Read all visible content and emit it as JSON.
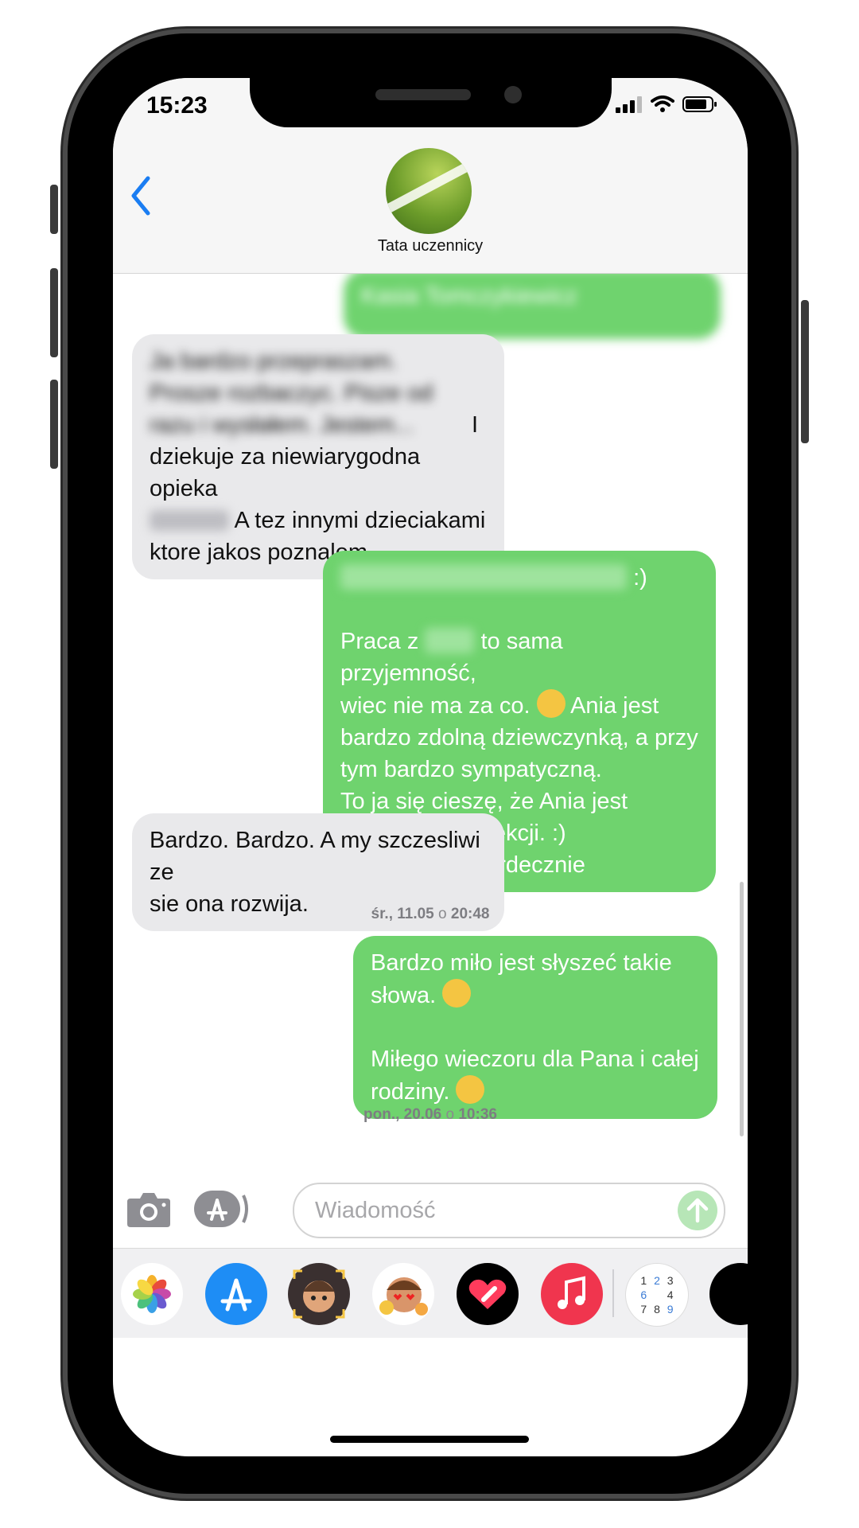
{
  "status": {
    "time": "15:23"
  },
  "header": {
    "contact_name": "Tata uczennicy",
    "back_icon": "chevron-left-icon"
  },
  "messages": [
    {
      "type": "out",
      "text": "Kasia Tomczykiewicz",
      "blurred": true
    },
    {
      "type": "in",
      "text_blurred": "Ja bardzo przepraszam. Prosze rozbaczyc. Pisze od razu i wysłałem. Jestem...",
      "text_visible_1": "I",
      "text_visible_2": "dziekuje za niewiarygodna opieka",
      "text_visible_3": "A tez innymi dzieciakami",
      "text_visible_4": "ktore jakos poznalem."
    },
    {
      "type": "out",
      "line_1_suffix": ":)",
      "line_2": "Praca z",
      "line_2_suffix": "to sama przyjemność,",
      "rest": "wiec nie ma za co.",
      "rest_2": "Ania jest\nbardzo zdolną dziewczynką, a przy\ntym bardzo sympatyczną.\nTo ja się cieszę, że Ania jest\nzadowolona z lekcji. :)\nPozdrawiam serdecznie"
    },
    {
      "type": "in",
      "text": "Bardzo. Bardzo. A my szczesliwi ze\nsie ona rozwija."
    },
    {
      "type": "stamp",
      "day": "śr., 11.05",
      "sep": "o",
      "time": "20:48"
    },
    {
      "type": "out",
      "line_1": "Bardzo miło jest słyszeć takie\nsłowa.",
      "line_2": "\n\nMiłego wieczoru dla Pana i całej\nrodziny."
    },
    {
      "type": "stamp",
      "day": "pon., 20.06",
      "sep": "o",
      "time": "10:36"
    }
  ],
  "composer": {
    "placeholder": "Wiadomość",
    "camera_icon": "camera-icon",
    "apps_icon": "app-store-icon",
    "send_icon": "send-arrow-icon"
  },
  "dock": {
    "apps": [
      "photos-icon",
      "app-store-icon",
      "memoji-icon",
      "memoji-stickers-icon",
      "digital-touch-icon",
      "music-icon",
      "sudoku-icon"
    ],
    "sudoku_digits": [
      "1",
      "2",
      "3",
      "6",
      "4",
      "7",
      "8",
      "9"
    ]
  }
}
